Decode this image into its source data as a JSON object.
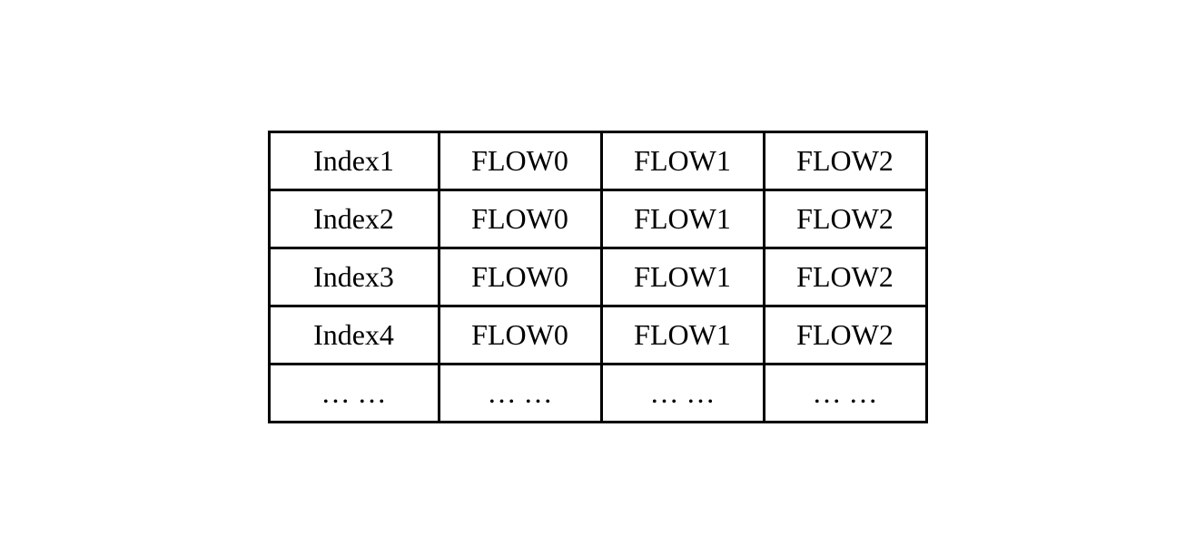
{
  "table": {
    "rows": [
      {
        "index": "Index1",
        "flow0": "FLOW0",
        "flow1": "FLOW1",
        "flow2": "FLOW2"
      },
      {
        "index": "Index2",
        "flow0": "FLOW0",
        "flow1": "FLOW1",
        "flow2": "FLOW2"
      },
      {
        "index": "Index3",
        "flow0": "FLOW0",
        "flow1": "FLOW1",
        "flow2": "FLOW2"
      },
      {
        "index": "Index4",
        "flow0": "FLOW0",
        "flow1": "FLOW1",
        "flow2": "FLOW2"
      },
      {
        "index": "… …",
        "flow0": "… …",
        "flow1": "… …",
        "flow2": "… …"
      }
    ]
  }
}
